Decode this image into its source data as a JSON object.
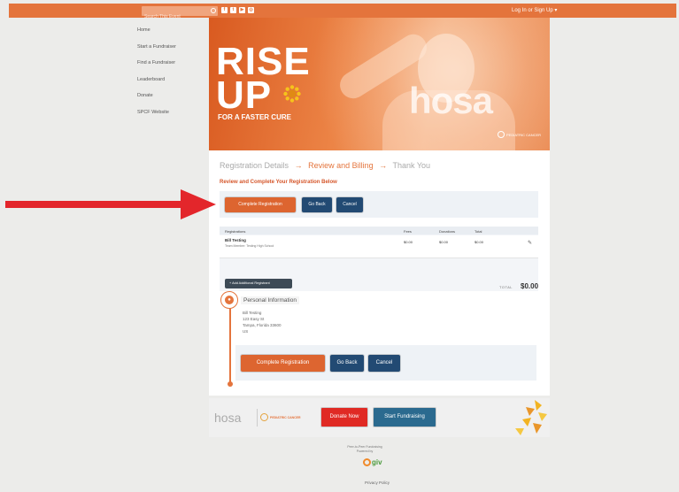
{
  "topbar": {
    "search_placeholder": "Search This Event",
    "social_icons": [
      "facebook-icon",
      "twitter-icon",
      "youtube-icon",
      "instagram-icon"
    ],
    "login": "Log In or Sign Up  ▾"
  },
  "sidebar": {
    "items": [
      "Home",
      "Start a Fundraiser",
      "Find a Fundraiser",
      "Leaderboard",
      "Donate",
      "SPCF Website"
    ]
  },
  "hero": {
    "line1": "RISE",
    "line2": "UP",
    "tagline": "FOR A FASTER CURE",
    "brand_watermark": "hosa",
    "partner_logo": "PEDIATRIC CANCER"
  },
  "steps": {
    "step1": "Registration Details",
    "separator": "→",
    "step2": "Review and Billing",
    "step3": "Thank You"
  },
  "review_title": "Review and Complete Your Registration Below",
  "buttons": {
    "complete": "Complete Registration",
    "go_back": "Go Back",
    "cancel": "Cancel"
  },
  "registrations": {
    "headers": [
      "Registrations",
      "Fees",
      "Donations",
      "Total"
    ],
    "rows": [
      {
        "name": "Bill Testing",
        "sub": "Team Member: Testing High School",
        "fees": "$0.00",
        "donations": "$0.00",
        "total": "$0.00"
      }
    ],
    "add_button": "+ Add Additional Registrant"
  },
  "total": {
    "label": "TOTAL",
    "value": "$0.00"
  },
  "personal": {
    "title": "Personal Information",
    "lines": [
      "Bill Testing",
      "123 Easy St",
      "Tampa, Florida 33600",
      "US"
    ]
  },
  "footer": {
    "hosa": "hosa",
    "hosa_small": "Future Health Professionals",
    "cure_prefix": "SUNSHINE PROJECT",
    "cure_brand": "PEDIATRIC CANCER",
    "donate": "Donate Now",
    "fundraise": "Start Fundraising"
  },
  "powered": {
    "line1": "Peer-to-Peer Fundraising",
    "line2": "Powered by",
    "brand": "giv",
    "privacy": "Privacy Policy"
  },
  "colors": {
    "accent": "#e4743c",
    "navy": "#224a73",
    "orange_button": "#dd6530",
    "donate_red": "#e02a24",
    "fundraise_blue": "#2b6a8f",
    "arrow_red": "#e3262b"
  }
}
